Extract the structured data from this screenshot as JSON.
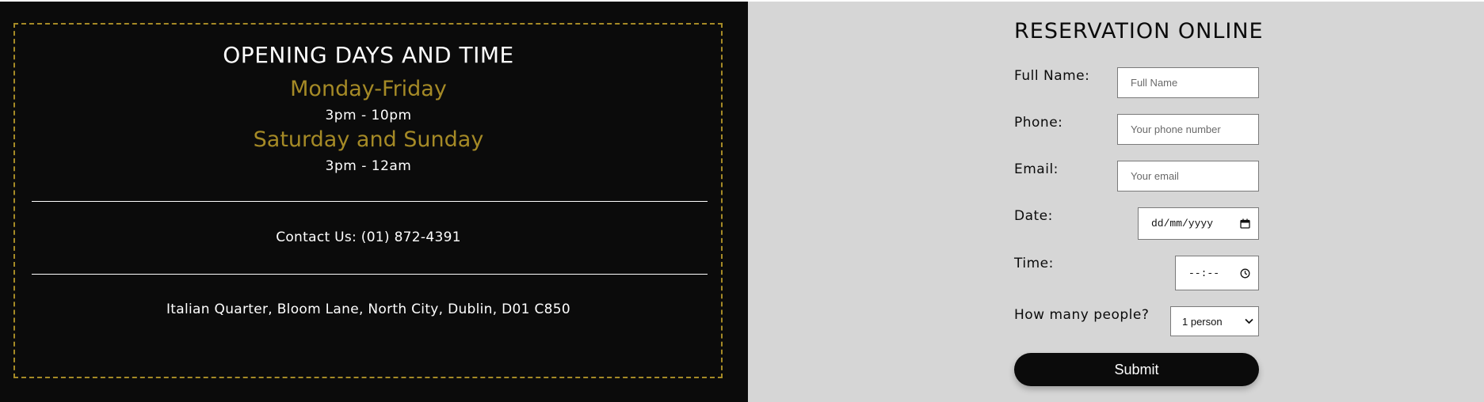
{
  "hours": {
    "title": "OPENING DAYS AND TIME",
    "weekdays_label": "Monday-Friday",
    "weekdays_time": "3pm - 10pm",
    "weekend_label": "Saturday and Sunday",
    "weekend_time": "3pm - 12am"
  },
  "contact": {
    "text": "Contact Us: (01) 872-4391"
  },
  "address": {
    "text": "Italian Quarter, Bloom Lane, North City, Dublin, D01 C850"
  },
  "form": {
    "title": "RESERVATION ONLINE",
    "full_name": {
      "label": "Full Name:",
      "placeholder": "Full Name"
    },
    "phone": {
      "label": "Phone:",
      "placeholder": "Your phone number"
    },
    "email": {
      "label": "Email:",
      "placeholder": "Your email"
    },
    "date": {
      "label": "Date:",
      "value": "dd/mm/yyyy"
    },
    "time": {
      "label": "Time:",
      "value": "--:--"
    },
    "people": {
      "label": "How many people?",
      "selected": "1 person"
    },
    "submit_label": "Submit"
  },
  "icons": {
    "date": "calendar-icon",
    "time": "clock-icon",
    "select": "chevron-down-icon"
  },
  "colors": {
    "dark_bg": "#0b0b0b",
    "gold": "#a58a26",
    "light_bg": "#d6d6d6"
  }
}
